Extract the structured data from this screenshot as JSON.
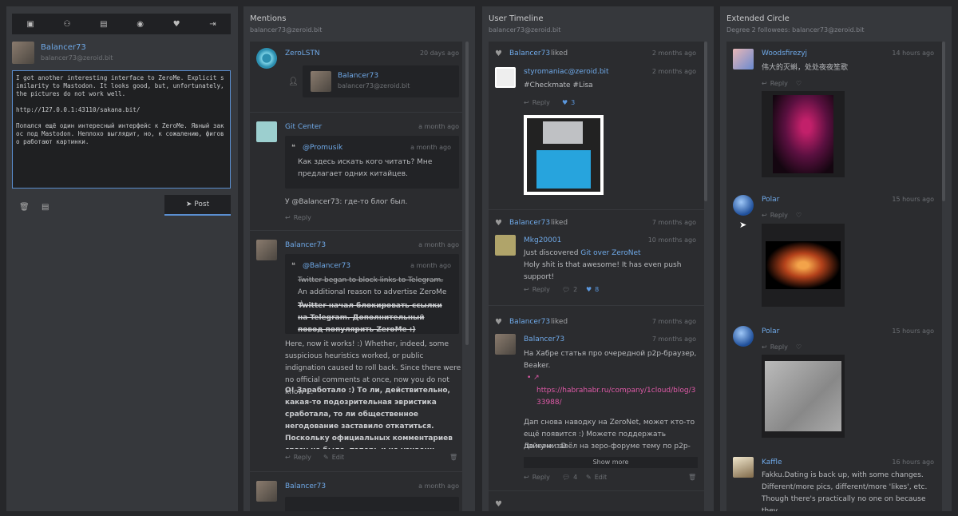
{
  "toolbar": {
    "icons": [
      "user-card-icon",
      "users-icon",
      "image-icon",
      "globe-icon",
      "heart-icon",
      "logout-icon"
    ]
  },
  "profile": {
    "name": "Balancer73",
    "handle": "balancer73@zeroid.bit"
  },
  "composer": {
    "text": "I got another interesting interface to ZeroMe. Explicit similarity to Mastodon. It looks good, but, unfortunately, the pictures do not work well.\n\nhttp://127.0.0.1:43110/sakana.bit/\n\nПопался ещё один интересный интерфейс к ZeroMe. Явный закос под Mastodon. Неплохо выглядит, но, к сожалению, фигово работают картинки.",
    "post_label": "Post"
  },
  "mentions": {
    "title": "Mentions",
    "sub": "balancer73@zeroid.bit",
    "items": [
      {
        "name": "ZeroLSTN",
        "time": "20 days ago",
        "follow_name": "Balancer73",
        "follow_handle": "balancer73@zeroid.bit"
      },
      {
        "name": "Git Center",
        "time": "a month ago",
        "quote_name": "@Promusik",
        "quote_time": "a month ago",
        "quote_text": "Как здесь искать кого читать? Мне предлагает одних китайцев.",
        "body": "У @Balancer73: где-то блог был.",
        "reply": "Reply"
      },
      {
        "name": "Balancer73",
        "time": "a month ago",
        "quote_name": "@Balancer73",
        "quote_time": "a month ago",
        "quote_strike1": "Twitter began to block links to Telegram.",
        "quote_rest1": " An additional reason to advertise ZeroMe :)",
        "quote_strike2": "Twitter начал блокировать ссылки на Telegram. Дополнительный повод популярить ZeroMe :)",
        "body": "Here, now it works! :) Whether, indeed, some suspicious heuristics worked, or public indignation caused to roll back. Since there were no official comments at once, now you do not know ...",
        "body_ru": "О! Заработало :) То ли, действительно, какая-то подозрительная эвристика сработала, то ли общественное негодование заставило откатиться. Поскольку официальных комментариев сразу не было, теперь и не узнаешь...",
        "reply": "Reply",
        "edit": "Edit"
      },
      {
        "name": "Balancer73",
        "time": "a month ago"
      }
    ]
  },
  "timeline": {
    "title": "User Timeline",
    "sub": "balancer73@zeroid.bit",
    "items": [
      {
        "liker": "Balancer73",
        "liked": "liked",
        "time": "2 months ago",
        "name": "styromaniac@zeroid.bit",
        "ptime": "2 months ago",
        "body": "#Checkmate #Lisa",
        "reply": "Reply",
        "likes": "3"
      },
      {
        "liker": "Balancer73",
        "liked": "liked",
        "time": "7 months ago",
        "name": "Mkg20001",
        "ptime": "10 months ago",
        "pre": "Just discovered ",
        "link": "Git over ZeroNet",
        "body": "Holy shit is that awesome! It has even push support!",
        "reply": "Reply",
        "comments": "2",
        "likes": "8"
      },
      {
        "liker": "Balancer73",
        "liked": "liked",
        "time": "7 months ago",
        "name": "Balancer73",
        "ptime": "7 months ago",
        "body": "На Хабре статья про очередной p2p-браузер, Beaker.",
        "url": "https://habrahabr.ru/company/1cloud/blog/333988/",
        "body2": "Дап снова наводку на ZeroNet, может кто-то ещё появится :) Можете поддержать лайками :D",
        "body3": "До кучи завёл на зеро-форуме тему по p2p-",
        "more": "Show more",
        "reply": "Reply",
        "comments": "4",
        "edit": "Edit"
      }
    ]
  },
  "circle": {
    "title": "Extended Circle",
    "sub": "Degree 2 followees: balancer73@zeroid.bit",
    "items": [
      {
        "name": "Woodsfirezyj",
        "time": "14 hours ago",
        "body": "伟大的灭蝌，处处夜夜笙歌",
        "reply": "Reply"
      },
      {
        "name": "Polar",
        "time": "15 hours ago",
        "reply": "Reply"
      },
      {
        "name": "Polar",
        "time": "15 hours ago",
        "reply": "Reply"
      },
      {
        "name": "Kaffle",
        "time": "16 hours ago",
        "body": "Fakku.Dating is back up, with some changes. Different/more pics, different/more 'likes', etc. Though there's practically no one on because they"
      }
    ]
  }
}
